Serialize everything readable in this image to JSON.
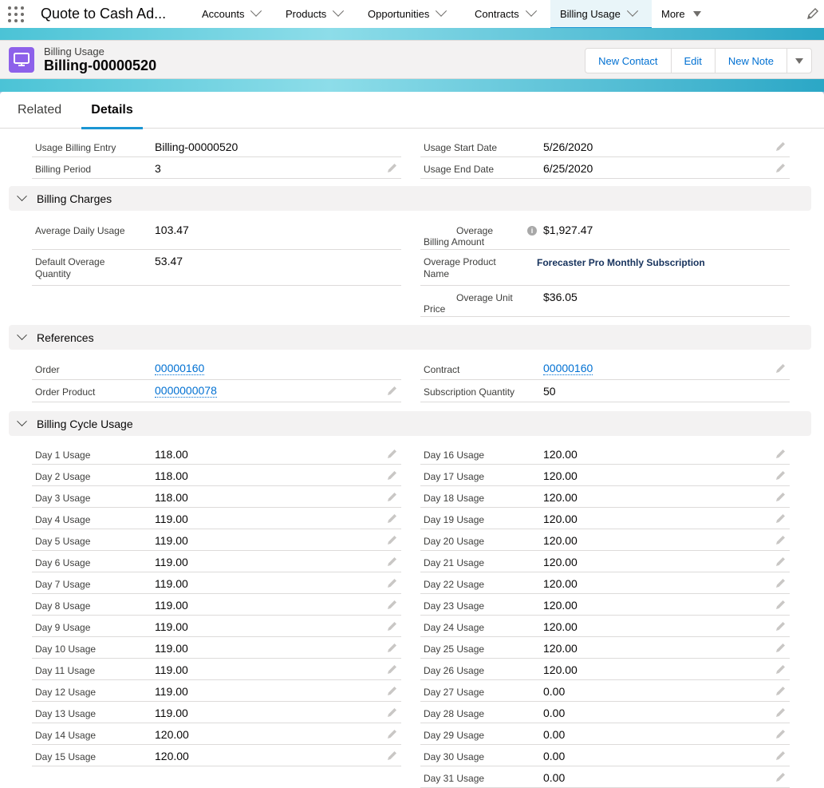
{
  "nav": {
    "app_name": "Quote to Cash Ad...",
    "items": [
      {
        "label": "Accounts"
      },
      {
        "label": "Products"
      },
      {
        "label": "Opportunities"
      },
      {
        "label": "Contracts"
      },
      {
        "label": "Billing Usage"
      }
    ],
    "more_label": "More"
  },
  "header": {
    "object_label": "Billing Usage",
    "record_name": "Billing-00000520",
    "actions": {
      "new_contact": "New Contact",
      "edit": "Edit",
      "new_note": "New Note"
    }
  },
  "tabs": {
    "related": "Related",
    "details": "Details"
  },
  "top_fields": {
    "usage_billing_entry": {
      "label": "Usage Billing Entry",
      "value": "Billing-00000520"
    },
    "billing_period": {
      "label": "Billing Period",
      "value": "3"
    },
    "usage_start_date": {
      "label": "Usage Start Date",
      "value": "5/26/2020"
    },
    "usage_end_date": {
      "label": "Usage End Date",
      "value": "6/25/2020"
    }
  },
  "billing_charges": {
    "title": "Billing Charges",
    "average_daily_usage": {
      "label": "Average Daily Usage",
      "value": "103.47"
    },
    "default_overage_quantity": {
      "label": "Default Overage Quantity",
      "value": "53.47"
    },
    "overage_billing_amount": {
      "label_line1": "Overage",
      "label_line2": "Billing Amount",
      "value": "$1,927.47"
    },
    "overage_product_name": {
      "label": "Overage Product Name",
      "value": "Forecaster Pro Monthly Subscription"
    },
    "overage_unit_price": {
      "label_line1": "Overage Unit",
      "label_line2": "Price",
      "value": "$36.05"
    }
  },
  "references": {
    "title": "References",
    "order": {
      "label": "Order",
      "value": "00000160"
    },
    "order_product": {
      "label": "Order Product",
      "value": "0000000078"
    },
    "contract": {
      "label": "Contract",
      "value": "00000160"
    },
    "subscription_quantity": {
      "label": "Subscription Quantity",
      "value": "50"
    }
  },
  "billing_cycle_usage": {
    "title": "Billing Cycle Usage",
    "left": [
      {
        "label": "Day 1 Usage",
        "value": "118.00"
      },
      {
        "label": "Day 2 Usage",
        "value": "118.00"
      },
      {
        "label": "Day 3 Usage",
        "value": "118.00"
      },
      {
        "label": "Day 4 Usage",
        "value": "119.00"
      },
      {
        "label": "Day 5 Usage",
        "value": "119.00"
      },
      {
        "label": "Day 6 Usage",
        "value": "119.00"
      },
      {
        "label": "Day 7 Usage",
        "value": "119.00"
      },
      {
        "label": "Day 8 Usage",
        "value": "119.00"
      },
      {
        "label": "Day 9 Usage",
        "value": "119.00"
      },
      {
        "label": "Day 10 Usage",
        "value": "119.00"
      },
      {
        "label": "Day 11 Usage",
        "value": "119.00"
      },
      {
        "label": "Day 12 Usage",
        "value": "119.00"
      },
      {
        "label": "Day 13 Usage",
        "value": "119.00"
      },
      {
        "label": "Day 14 Usage",
        "value": "120.00"
      },
      {
        "label": "Day 15 Usage",
        "value": "120.00"
      }
    ],
    "right": [
      {
        "label": "Day 16 Usage",
        "value": "120.00"
      },
      {
        "label": "Day 17 Usage",
        "value": "120.00"
      },
      {
        "label": "Day 18 Usage",
        "value": "120.00"
      },
      {
        "label": "Day 19 Usage",
        "value": "120.00"
      },
      {
        "label": "Day 20 Usage",
        "value": "120.00"
      },
      {
        "label": "Day 21 Usage",
        "value": "120.00"
      },
      {
        "label": "Day 22 Usage",
        "value": "120.00"
      },
      {
        "label": "Day 23 Usage",
        "value": "120.00"
      },
      {
        "label": "Day 24 Usage",
        "value": "120.00"
      },
      {
        "label": "Day 25 Usage",
        "value": "120.00"
      },
      {
        "label": "Day 26 Usage",
        "value": "120.00"
      },
      {
        "label": "Day 27 Usage",
        "value": "0.00"
      },
      {
        "label": "Day 28 Usage",
        "value": "0.00"
      },
      {
        "label": "Day 29 Usage",
        "value": "0.00"
      },
      {
        "label": "Day 30 Usage",
        "value": "0.00"
      },
      {
        "label": "Day 31 Usage",
        "value": "0.00"
      }
    ]
  }
}
